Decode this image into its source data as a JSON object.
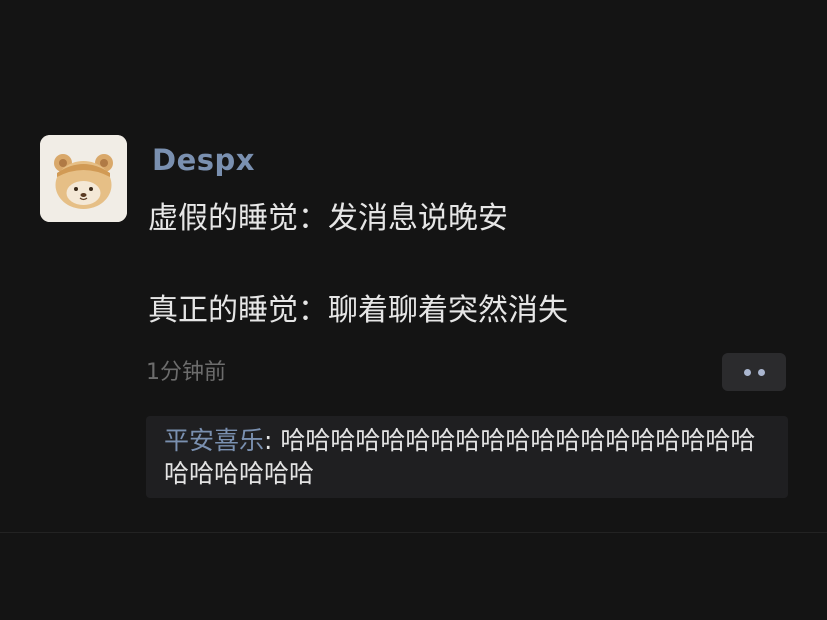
{
  "post": {
    "author": "Despx",
    "avatar_icon": "bear-avatar-icon",
    "lines": [
      "虚假的睡觉：发消息说晚安",
      "真正的睡觉：聊着聊着突然消失"
    ],
    "time": "1分钟前",
    "more_icon": "more-dots-icon"
  },
  "comments": [
    {
      "name": "平安喜乐",
      "separator": ": ",
      "text": "哈哈哈哈哈哈哈哈哈哈哈哈哈哈哈哈哈哈哈哈哈哈哈哈哈"
    }
  ],
  "colors": {
    "background": "#141414",
    "name_link": "#7a90b0",
    "text": "#e6e6e6",
    "muted": "#6c6c6c",
    "comment_bg": "#1f1f21"
  }
}
